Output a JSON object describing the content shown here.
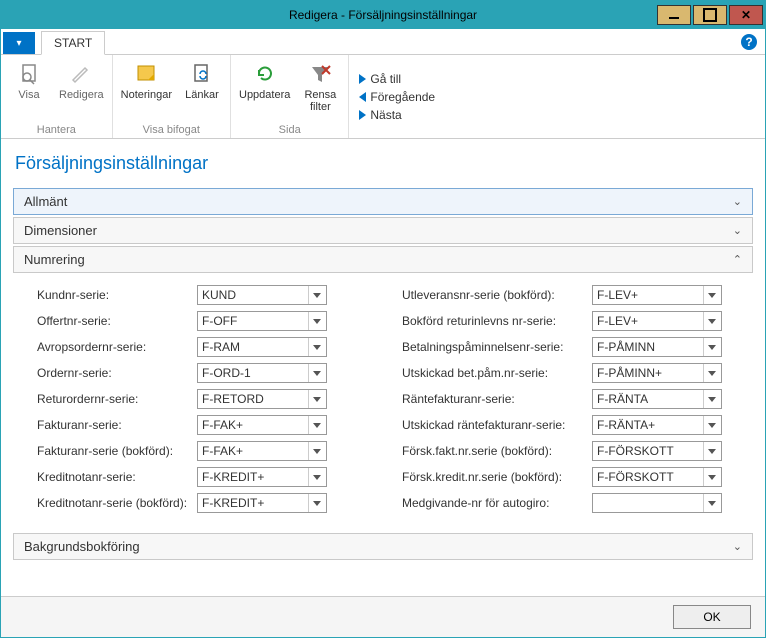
{
  "window": {
    "title": "Redigera - Försäljningsinställningar"
  },
  "tabs": {
    "file_dropdown": "▾",
    "start": "START"
  },
  "ribbon": {
    "groups": {
      "hantera": {
        "label": "Hantera",
        "visa": "Visa",
        "redigera": "Redigera"
      },
      "visa_bifogat": {
        "label": "Visa bifogat",
        "noteringar": "Noteringar",
        "lankar": "Länkar"
      },
      "sida": {
        "label": "Sida",
        "uppdatera": "Uppdatera",
        "rensa_filter": "Rensa\nfilter"
      }
    },
    "nav": {
      "ga_till": "Gå till",
      "foregaende": "Föregående",
      "nasta": "Nästa"
    }
  },
  "page": {
    "title": "Försäljningsinställningar"
  },
  "sections": {
    "allmant": "Allmänt",
    "dimensioner": "Dimensioner",
    "numrering": "Numrering",
    "bakgrundsbokforing": "Bakgrundsbokföring"
  },
  "fields": {
    "left": [
      {
        "label": "Kundnr-serie:",
        "value": "KUND"
      },
      {
        "label": "Offertnr-serie:",
        "value": "F-OFF"
      },
      {
        "label": "Avropsordernr-serie:",
        "value": "F-RAM"
      },
      {
        "label": "Ordernr-serie:",
        "value": "F-ORD-1"
      },
      {
        "label": "Returordernr-serie:",
        "value": "F-RETORD"
      },
      {
        "label": "Fakturanr-serie:",
        "value": "F-FAK+"
      },
      {
        "label": "Fakturanr-serie (bokförd):",
        "value": "F-FAK+"
      },
      {
        "label": "Kreditnotanr-serie:",
        "value": "F-KREDIT+"
      },
      {
        "label": "Kreditnotanr-serie (bokförd):",
        "value": "F-KREDIT+"
      }
    ],
    "right": [
      {
        "label": "Utleveransnr-serie (bokförd):",
        "value": "F-LEV+"
      },
      {
        "label": "Bokförd returinlevns nr-serie:",
        "value": "F-LEV+"
      },
      {
        "label": "Betalningspåminnelsenr-serie:",
        "value": "F-PÅMINN"
      },
      {
        "label": "Utskickad bet.påm.nr-serie:",
        "value": "F-PÅMINN+"
      },
      {
        "label": "Räntefakturanr-serie:",
        "value": "F-RÄNTA"
      },
      {
        "label": "Utskickad räntefakturanr-serie:",
        "value": "F-RÄNTA+"
      },
      {
        "label": "Försk.fakt.nr.serie (bokförd):",
        "value": "F-FÖRSKOTT"
      },
      {
        "label": "Försk.kredit.nr.serie (bokförd):",
        "value": "F-FÖRSKOTT"
      },
      {
        "label": "Medgivande-nr för autogiro:",
        "value": ""
      }
    ]
  },
  "footer": {
    "ok": "OK"
  }
}
